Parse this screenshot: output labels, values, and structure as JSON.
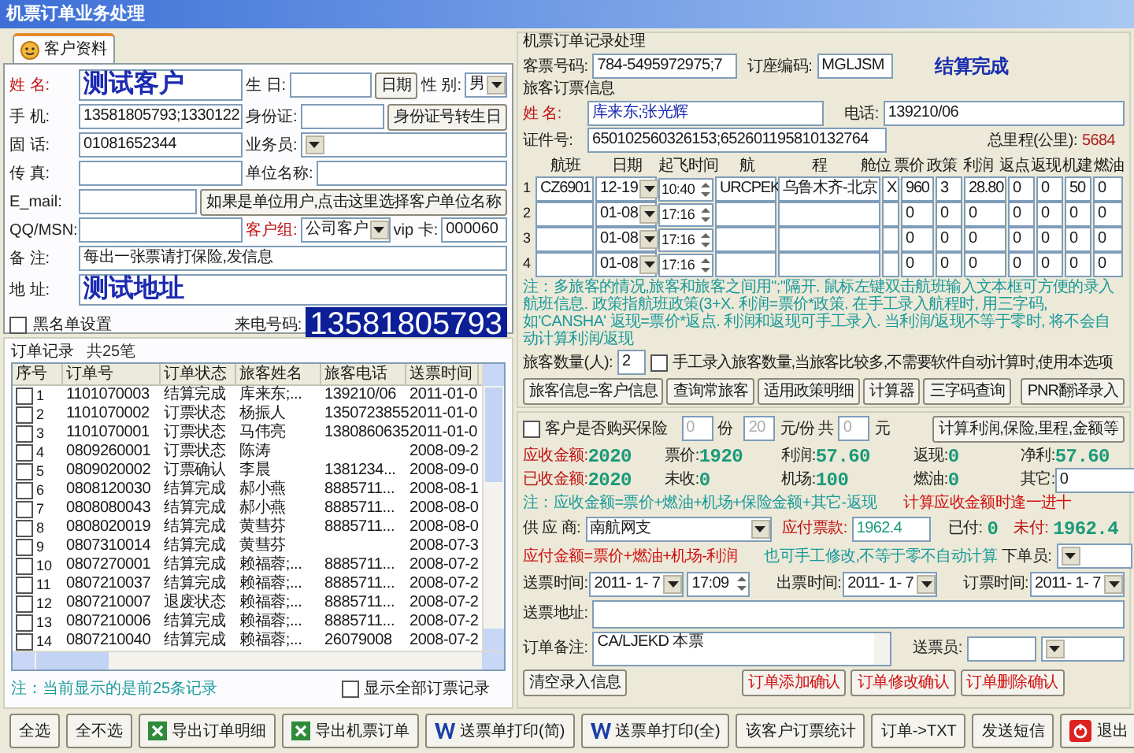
{
  "window": {
    "title": "机票订单业务处理"
  },
  "customer_tab": {
    "label": "客户资料",
    "selected": true
  },
  "customer": {
    "rows": [
      [
        {
          "kind": "label",
          "text": "姓 名:",
          "alert": true
        },
        {
          "kind": "input_large",
          "value": "测试客户"
        },
        {
          "kind": "label",
          "text": "生 日:",
          "alert": false
        },
        {
          "kind": "input"
        },
        {
          "kind": "button",
          "text": "日期"
        },
        {
          "kind": "label",
          "text": "性 别:",
          "alert": false
        },
        {
          "kind": "select",
          "value": "男"
        }
      ],
      [
        {
          "kind": "label",
          "text": "手 机:",
          "alert": false
        },
        {
          "kind": "input",
          "value": "13581805793;1330122"
        },
        {
          "kind": "label",
          "text": "身份证:",
          "alert": false
        },
        {
          "kind": "input"
        },
        {
          "kind": "button",
          "text": "身份证号转生日"
        }
      ],
      [
        {
          "kind": "label",
          "text": "固 话:",
          "alert": false
        },
        {
          "kind": "input",
          "value": "01081652344"
        },
        {
          "kind": "label",
          "text": "业务员:",
          "alert": false
        },
        {
          "kind": "select"
        }
      ],
      [
        {
          "kind": "label",
          "text": "传 真:",
          "alert": false
        },
        {
          "kind": "input"
        },
        {
          "kind": "label",
          "text": "单位名称:",
          "alert": false
        },
        {
          "kind": "input"
        }
      ],
      [
        {
          "kind": "label",
          "text": "E_mail:",
          "alert": false
        },
        {
          "kind": "input"
        },
        {
          "kind": "button",
          "text": "如果是单位用户,点击这里选择客户单位名称"
        }
      ],
      [
        {
          "kind": "label",
          "text": "QQ/MSN:",
          "alert": false
        },
        {
          "kind": "input"
        },
        {
          "kind": "label",
          "text": "客户组:",
          "alert": true
        },
        {
          "kind": "select",
          "value": "公司客户"
        },
        {
          "kind": "label",
          "text": "vip 卡:",
          "alert": false
        },
        {
          "kind": "input",
          "value": "000060"
        }
      ],
      [
        {
          "kind": "label",
          "text": "备 注:",
          "alert": false
        },
        {
          "kind": "input",
          "value": "每出一张票请打保险,发信息"
        }
      ],
      [
        {
          "kind": "label",
          "text": "地 址:",
          "alert": false
        },
        {
          "kind": "input_large",
          "value": "测试地址"
        }
      ],
      [
        {
          "kind": "checkbox",
          "text": "黑名单设置",
          "checked": false
        },
        {
          "kind": "label",
          "text": "来电号码:",
          "alert": false
        },
        {
          "kind": "caller",
          "value": "13581805793"
        }
      ]
    ]
  },
  "orders": {
    "title": "订单记录",
    "count": "共25笔",
    "columns": [
      "序号",
      "订单号",
      "订单状态",
      "旅客姓名",
      "旅客电话",
      "送票时间"
    ],
    "rows": [
      {
        "checked": false,
        "no": "1",
        "order_no": "1101070003",
        "status": "结算完成",
        "passenger": "库来东;...",
        "phone": "139210/06",
        "time": "2011-01-0"
      },
      {
        "checked": false,
        "no": "2",
        "order_no": "1101070002",
        "status": "订票状态",
        "passenger": "杨振人",
        "phone": "1350723855",
        "time": "2011-01-0"
      },
      {
        "checked": false,
        "no": "3",
        "order_no": "1101070001",
        "status": "订票状态",
        "passenger": "马伟亮",
        "phone": "1380860635",
        "time": "2011-01-0"
      },
      {
        "checked": false,
        "no": "4",
        "order_no": "0809260001",
        "status": "订票状态",
        "passenger": "陈涛",
        "time": "2008-09-2"
      },
      {
        "checked": false,
        "no": "5",
        "order_no": "0809020002",
        "status": "订票确认",
        "passenger": "李晨",
        "phone": "1381234...",
        "time": "2008-09-0"
      },
      {
        "checked": false,
        "no": "6",
        "order_no": "0808120030",
        "status": "结算完成",
        "passenger": "郝小燕",
        "phone": "8885711...",
        "time": "2008-08-1"
      },
      {
        "checked": false,
        "no": "7",
        "order_no": "0808080043",
        "status": "结算完成",
        "passenger": "郝小燕",
        "phone": "8885711...",
        "time": "2008-08-0"
      },
      {
        "checked": false,
        "no": "8",
        "order_no": "0808020019",
        "status": "结算完成",
        "passenger": "黄彗芬",
        "phone": "8885711...",
        "time": "2008-08-0"
      },
      {
        "checked": false,
        "no": "9",
        "order_no": "0807310014",
        "status": "结算完成",
        "passenger": "黄彗芬",
        "time": "2008-07-3"
      },
      {
        "checked": false,
        "no": "10",
        "order_no": "0807270001",
        "status": "结算完成",
        "passenger": "赖福蓉;...",
        "phone": "8885711...",
        "time": "2008-07-2"
      },
      {
        "checked": false,
        "no": "11",
        "order_no": "0807210037",
        "status": "结算完成",
        "passenger": "赖福蓉;...",
        "phone": "8885711...",
        "time": "2008-07-2"
      },
      {
        "checked": false,
        "no": "12",
        "order_no": "0807210007",
        "status": "退废状态",
        "passenger": "赖福蓉;...",
        "phone": "8885711...",
        "time": "2008-07-2"
      },
      {
        "checked": false,
        "no": "13",
        "order_no": "0807210006",
        "status": "结算完成",
        "passenger": "赖福蓉;...",
        "phone": "8885711...",
        "time": "2008-07-2"
      },
      {
        "checked": false,
        "no": "14",
        "order_no": "0807210040",
        "status": "结算完成",
        "passenger": "赖福蓉;...",
        "phone": "26079008",
        "time": "2008-07-2"
      }
    ],
    "note": "注：当前显示的是前25条记录",
    "show_all": {
      "label": "显示全部订票记录",
      "checked": false
    }
  },
  "order_panel": {
    "title": "机票订单记录处理",
    "ticket_no": {
      "label": "客票号码:",
      "value": "784-5495972975;7"
    },
    "booking_code": {
      "label": "订座编码:",
      "value": "MGLJSM"
    },
    "status": "结算完成"
  },
  "passenger": {
    "title": "旅客订票信息",
    "name": {
      "label": "姓 名:",
      "value": "库来东;张光辉"
    },
    "phone": {
      "label": "电话:",
      "value": "139210/06"
    },
    "id_no": {
      "label": "证件号:",
      "value": "650102560326153;652601195810132764"
    },
    "mileage": {
      "label": "总里程(公里):",
      "value": "5684"
    }
  },
  "flights": {
    "columns": [
      "航班",
      "日期",
      "起飞时间",
      "航",
      "程",
      "舱位",
      "票价",
      "政策",
      "利润",
      "返点",
      "返现",
      "机建",
      "燃油"
    ],
    "rows": [
      {
        "no": "1",
        "flight": "CZ6901",
        "date": "12-19",
        "time": "10:40",
        "code": "URCPEK",
        "route": "乌鲁木齐-北京",
        "cabin": "X",
        "price": "960",
        "policy": "3",
        "profit": "28.80",
        "rebate": "0",
        "rebate_cash": "0",
        "airport": "50",
        "fuel": "0"
      },
      {
        "no": "2",
        "date": "01-08",
        "time": "17:16",
        "price": "0",
        "policy": "0",
        "profit": "0",
        "rebate": "0",
        "rebate_cash": "0",
        "airport": "0",
        "fuel": "0"
      },
      {
        "no": "3",
        "date": "01-08",
        "time": "17:16",
        "price": "0",
        "policy": "0",
        "profit": "0",
        "rebate": "0",
        "rebate_cash": "0",
        "airport": "0",
        "fuel": "0"
      },
      {
        "no": "4",
        "date": "01-08",
        "time": "17:16",
        "price": "0",
        "policy": "0",
        "profit": "0",
        "rebate": "0",
        "rebate_cash": "0",
        "airport": "0",
        "fuel": "0"
      }
    ]
  },
  "flight_note": "注：多旅客的情况,旅客和旅客之间用\";\"隔开. 鼠标左键双击航班输入文本框可方便的录入航班信息. 政策指航班政策(3+X. 利润=票价*政策. 在手工录入航程时, 用三字码, 如'CANSHA' 返现=票价*返点. 利润和返现可手工录入. 当利润/返现不等于零时, 将不会自动计算利润/返现",
  "passenger_count": {
    "label": "旅客数量(人):",
    "value": "2"
  },
  "manual_count": {
    "label": "手工录入旅客数量,当旅客比较多,不需要软件自动计算时,使用本选项",
    "checked": false
  },
  "tool_buttons": [
    "旅客信息=客户信息",
    "查询常旅客",
    "适用政策明细",
    "计算器",
    "三字码查询",
    "PNR翻译录入"
  ],
  "insurance": {
    "label": "客户是否购买保险",
    "checked": false,
    "copies": "0",
    "copies_unit": "份",
    "price": "20",
    "price_unit": "元/份 共",
    "total": "0",
    "total_unit": "元",
    "calc_button": "计算利润,保险,里程,金额等"
  },
  "amounts": [
    {
      "kind": "reading",
      "label": "应收金额:",
      "value": "2020",
      "alert": true
    },
    {
      "kind": "reading",
      "label": "票价:",
      "value": "1920",
      "alert": false
    },
    {
      "kind": "reading",
      "label": "利润:",
      "value": "57.60",
      "alert": false
    },
    {
      "kind": "reading",
      "label": "返现:",
      "value": "0",
      "alert": false
    },
    {
      "kind": "reading",
      "label": "净利:",
      "value": "57.60",
      "alert": false
    },
    {
      "kind": "reading",
      "label": "已收金额:",
      "value": "2020",
      "alert": true
    },
    {
      "kind": "reading",
      "label": "未收:",
      "value": "0",
      "alert": false
    },
    {
      "kind": "reading",
      "label": "机场:",
      "value": "100",
      "alert": false
    },
    {
      "kind": "reading",
      "label": "燃油:",
      "value": "0",
      "alert": false
    },
    {
      "kind": "input",
      "label": "其它:",
      "value": "0",
      "alert": false
    }
  ],
  "amount_notes": [
    {
      "text": "注：应收金额=票价+燃油+机场+保险金额+其它-返现",
      "alert": false
    },
    {
      "text": "计算应收金额时逢一进十",
      "alert": true
    }
  ],
  "supplier": {
    "label": "供 应 商:",
    "value": "南航网支"
  },
  "payable": {
    "label": "应付票款:",
    "value": "1962.4"
  },
  "paid": {
    "label": "已付:",
    "value": "0"
  },
  "unpaid": {
    "label": "未付:",
    "value": "1962.4"
  },
  "payable_notes": [
    {
      "text": "应付金额=票价+燃油+机场-利润",
      "alert": true
    },
    {
      "text": "也可手工修改,不等于零不自动计算",
      "alert": false
    }
  ],
  "issuer": {
    "label": "下单员:"
  },
  "times": [
    {
      "label": "送票时间:",
      "date": "2011- 1- 7",
      "time": "17:09"
    },
    {
      "label": "出票时间:",
      "date": "2011- 1- 7"
    },
    {
      "label": "订票时间:",
      "date": "2011- 1- 7"
    }
  ],
  "address": {
    "label": "送票地址:"
  },
  "remark": {
    "label": "订单备注:",
    "value": "CA/LJEKD 本票"
  },
  "courier": {
    "label": "送票员:"
  },
  "clear_button": "清空录入信息",
  "confirm_buttons": [
    "订单添加确认",
    "订单修改确认",
    "订单删除确认"
  ],
  "toolbar": [
    {
      "kind": "plain",
      "label": "全选"
    },
    {
      "kind": "plain",
      "label": "全不选"
    },
    {
      "kind": "sheet",
      "label": "导出订单明细"
    },
    {
      "kind": "sheet",
      "label": "导出机票订单"
    },
    {
      "kind": "doc",
      "label": "送票单打印(简)"
    },
    {
      "kind": "doc",
      "label": "送票单打印(全)"
    },
    {
      "kind": "plain",
      "label": "该客户订票统计"
    },
    {
      "kind": "plain",
      "label": "订单->TXT"
    },
    {
      "kind": "plain",
      "label": "发送短信"
    },
    {
      "kind": "exit",
      "label": "退出"
    }
  ]
}
